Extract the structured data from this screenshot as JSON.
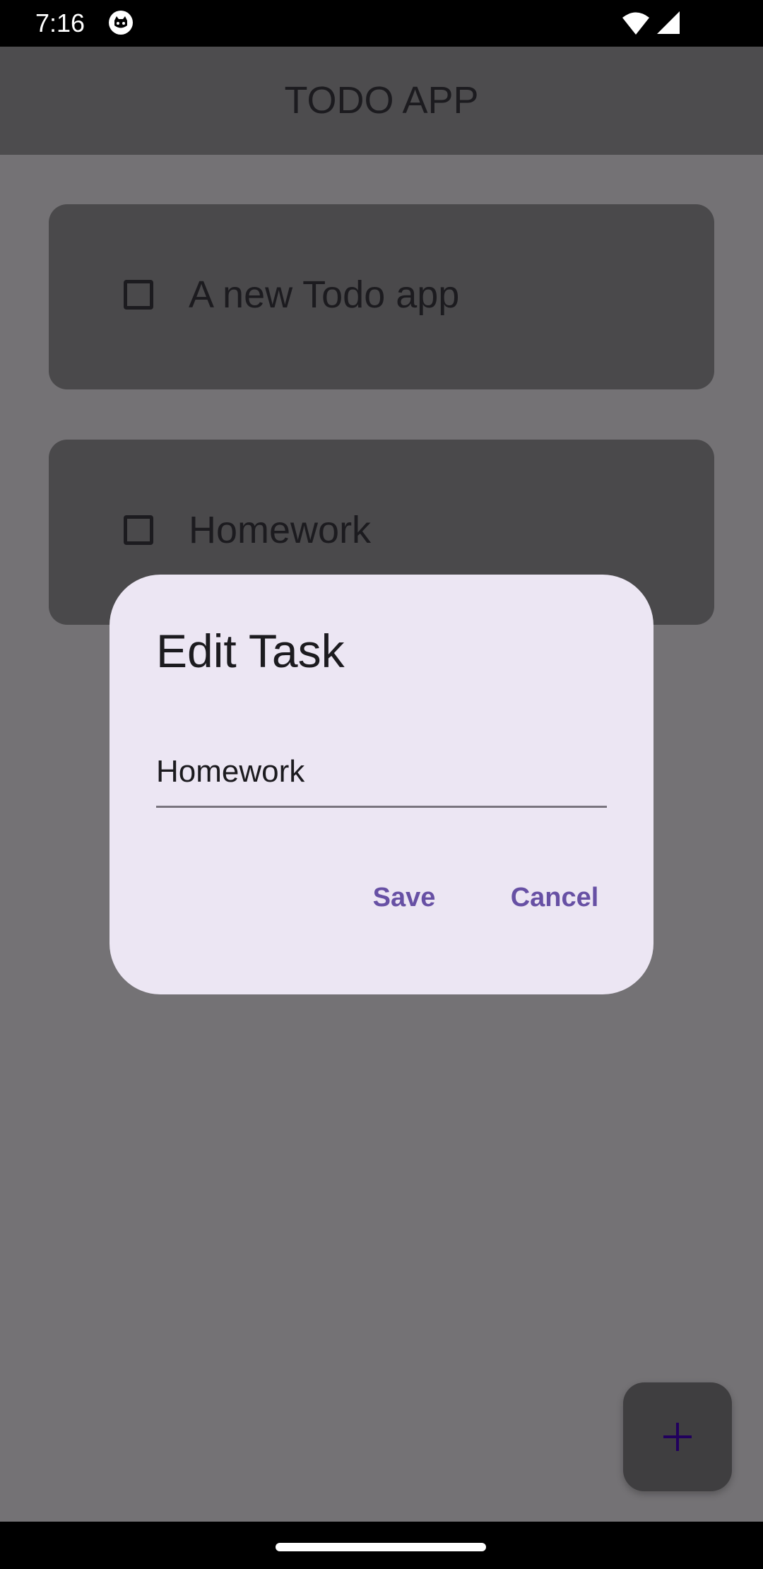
{
  "status_bar": {
    "time": "7:16",
    "icons": [
      "app-notification-icon",
      "wifi-icon",
      "cellular-signal-icon"
    ]
  },
  "app_bar": {
    "title": "TODO APP"
  },
  "tasks": [
    {
      "label": "A new Todo app",
      "checked": false
    },
    {
      "label": "Homework",
      "checked": false
    }
  ],
  "dialog": {
    "title": "Edit Task",
    "input_value": "Homework",
    "save_label": "Save",
    "cancel_label": "Cancel"
  },
  "fab": {
    "icon": "plus-icon"
  },
  "colors": {
    "scrim_background": "#747275",
    "dialog_background": "#ece6f3",
    "accent": "#6750a4",
    "text": "#1c1b1f"
  }
}
